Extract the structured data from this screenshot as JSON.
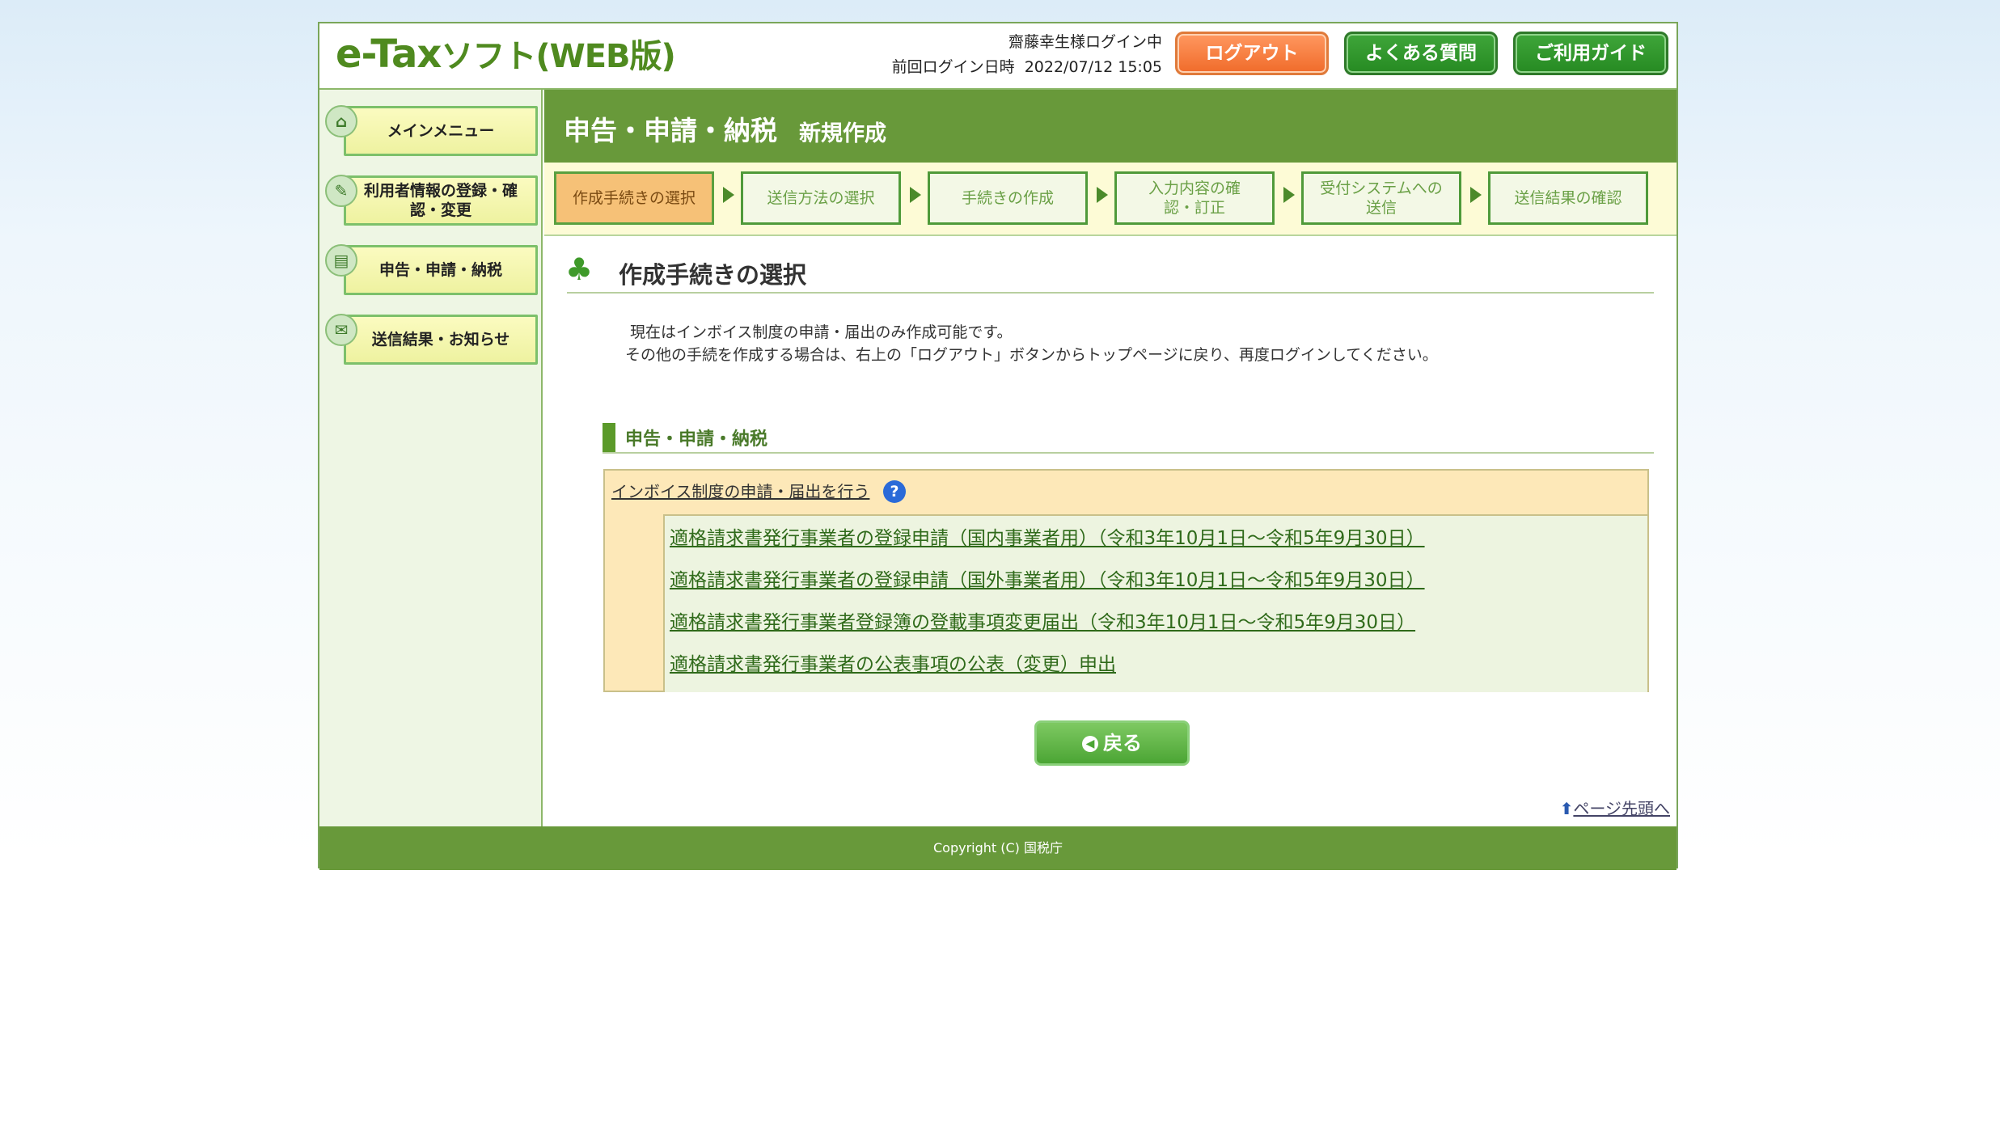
{
  "header": {
    "logo": "e-Tax",
    "logo_sub": "ソフト(WEB版)",
    "user_line": "齋藤幸生様ログイン中",
    "last_login_label": "前回ログイン日時",
    "last_login_value": "2022/07/12 15:05",
    "logout": "ログアウト",
    "faq": "よくある質問",
    "guide": "ご利用ガイド"
  },
  "sidebar": {
    "items": [
      {
        "label": "メインメニュー",
        "icon": "home-icon"
      },
      {
        "label": "利用者情報の登録・確認・変更",
        "icon": "user-info-icon"
      },
      {
        "label": "申告・申請・納税",
        "icon": "document-icon"
      },
      {
        "label": "送信結果・お知らせ",
        "icon": "notice-icon"
      }
    ]
  },
  "title": {
    "main": "申告・申請・納税",
    "sub": "新規作成"
  },
  "steps": [
    "作成手続きの選択",
    "送信方法の選択",
    "手続きの作成",
    "入力内容の確認・訂正",
    "受付システムへの送信",
    "送信結果の確認"
  ],
  "section_title": "作成手続きの選択",
  "notice": {
    "line1": "現在はインボイス制度の申請・届出のみ作成可能です。",
    "line2": "その他の手続を作成する場合は、右上の「ログアウト」ボタンからトップページに戻り、再度ログインしてください。"
  },
  "subheading": "申告・申請・納税",
  "procedure_box": {
    "header": "インボイス制度の申請・届出を行う",
    "help": "?",
    "links": [
      "適格請求書発行事業者の登録申請（国内事業者用）（令和3年10月1日～令和5年9月30日）",
      "適格請求書発行事業者の登録申請（国外事業者用）（令和3年10月1日～令和5年9月30日）",
      "適格請求書発行事業者登録簿の登載事項変更届出（令和3年10月1日～令和5年9月30日）",
      "適格請求書発行事業者の公表事項の公表（変更）申出"
    ]
  },
  "back_button": "戻る",
  "page_top": "ページ先頭へ",
  "footer": "Copyright (C) 国税庁",
  "colors": {
    "brand_green": "#68993a",
    "logout_orange": "#f06b2a",
    "active_step": "#f6c177"
  }
}
